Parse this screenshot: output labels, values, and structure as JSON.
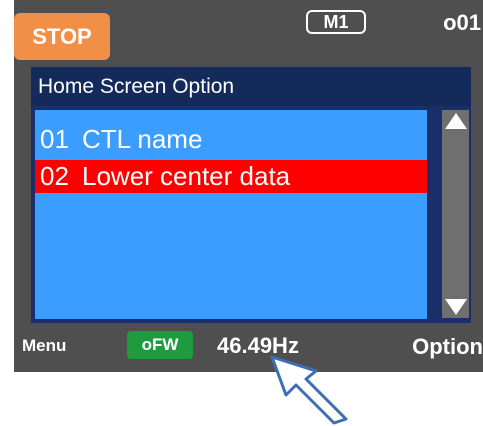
{
  "header": {
    "stop_label": "STOP",
    "mode_badge": "M1",
    "code": "o01"
  },
  "screen": {
    "title": "Home Screen Option",
    "items": [
      {
        "num": "01",
        "label": "CTL name",
        "selected": false
      },
      {
        "num": "02",
        "label": "Lower center data",
        "selected": true
      }
    ]
  },
  "scrollbar": {
    "up_icon": "triangle-up-icon",
    "down_icon": "triangle-down-icon"
  },
  "footer": {
    "menu_label": "Menu",
    "status_badge": "oFW",
    "frequency": "46.49Hz",
    "option_label": "Option"
  },
  "colors": {
    "panel_bg": "#4f4f4f",
    "stop_bg": "#f28f46",
    "title_bar_bg": "#142a5b",
    "list_bg": "#3b9dff",
    "selected_bg": "#ff0000",
    "status_green": "#1f9b3f",
    "arrow_stroke": "#3d6fb5"
  }
}
